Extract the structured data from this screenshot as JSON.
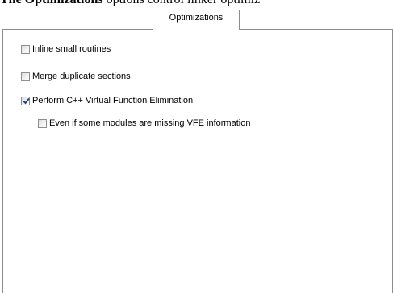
{
  "document": {
    "heading_bold": "The Optimizations",
    "heading_rest": " options control linker optimiz"
  },
  "tabs": [
    {
      "label": "Optimizations",
      "active": true
    }
  ],
  "options": [
    {
      "label": "Inline small routines",
      "checked": false
    },
    {
      "label": "Merge duplicate sections",
      "checked": false
    },
    {
      "label": "Perform C++ Virtual Function Elimination",
      "checked": true
    },
    {
      "label": "Even if some modules are missing VFE information",
      "checked": false
    }
  ],
  "colors": {
    "check_mark": "#1d3f7a",
    "border": "#8c8c8c"
  }
}
